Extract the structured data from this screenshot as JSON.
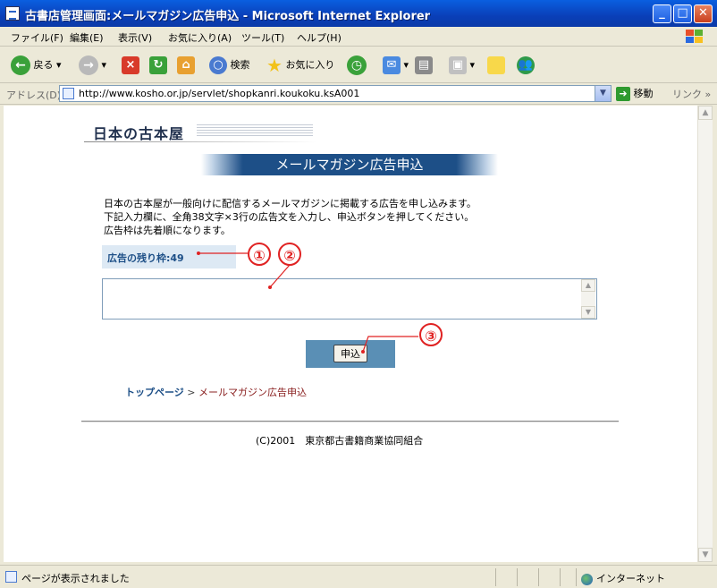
{
  "window": {
    "title": "古書店管理画面:メールマガジン広告申込 - Microsoft Internet Explorer"
  },
  "menu": [
    "ファイル(F)",
    "編集(E)",
    "表示(V)",
    "お気に入り(A)",
    "ツール(T)",
    "ヘルプ(H)"
  ],
  "toolbar": {
    "back": "戻る",
    "search": "検索",
    "favorites": "お気に入り"
  },
  "address": {
    "label": "アドレス(D)",
    "url": "http://www.kosho.or.jp/servlet/shopkanri.koukoku.ksA001",
    "go": "移動",
    "links": "リンク"
  },
  "page": {
    "logo": "日本の古本屋",
    "title": "メールマガジン広告申込",
    "intro": [
      "日本の古本屋が一般向けに配信するメールマガジンに掲載する広告を申し込みます。",
      "下記入力欄に、全角38文字×3行の広告文を入力し、申込ボタンを押してください。",
      "広告枠は先着順になります。"
    ],
    "remaining": "広告の残り枠:49",
    "ad_text_value": "",
    "submit": "申込",
    "breadcrumb": {
      "home": "トップページ",
      "separator": ">",
      "current": "メールマガジン広告申込"
    },
    "copyright": "(C)2001　東京都古書籍商業協同組合"
  },
  "annotations": [
    "①",
    "②",
    "③"
  ],
  "status": {
    "text": "ページが表示されました",
    "zone": "インターネット"
  },
  "colors": {
    "accent": "#1d4f87",
    "annotation": "#e02222",
    "titlebar": "#0a4fd0"
  }
}
